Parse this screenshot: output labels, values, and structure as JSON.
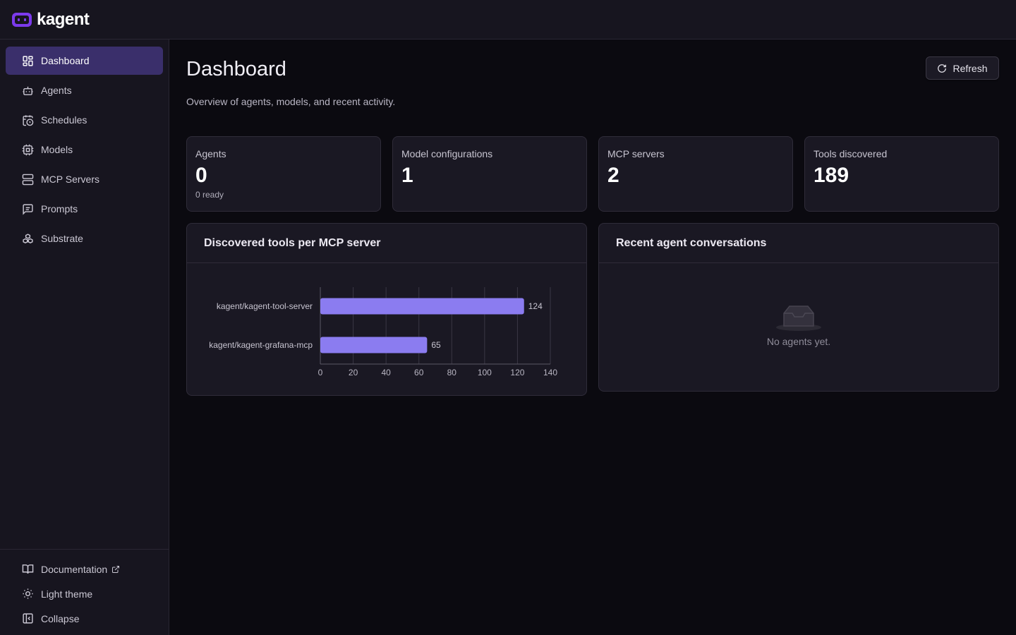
{
  "app": {
    "logo_text": "kagent",
    "brand_color": "#7c3aed"
  },
  "sidebar": {
    "items": [
      {
        "label": "Dashboard",
        "icon": "dashboard-icon",
        "active": true
      },
      {
        "label": "Agents",
        "icon": "bot-icon"
      },
      {
        "label": "Schedules",
        "icon": "calendar-clock-icon"
      },
      {
        "label": "Models",
        "icon": "cpu-icon"
      },
      {
        "label": "MCP Servers",
        "icon": "server-icon"
      },
      {
        "label": "Prompts",
        "icon": "message-square-icon"
      },
      {
        "label": "Substrate",
        "icon": "boxes-icon"
      }
    ],
    "footer": {
      "documentation": "Documentation",
      "theme": "Light theme",
      "collapse": "Collapse"
    }
  },
  "main": {
    "title": "Dashboard",
    "subtitle": "Overview of agents, models, and recent activity.",
    "refresh_label": "Refresh",
    "stats": [
      {
        "label": "Agents",
        "value": "0",
        "sub": "0 ready"
      },
      {
        "label": "Model configurations",
        "value": "1",
        "sub": ""
      },
      {
        "label": "MCP servers",
        "value": "2",
        "sub": ""
      },
      {
        "label": "Tools discovered",
        "value": "189",
        "sub": ""
      }
    ],
    "tools_panel_title": "Discovered tools per MCP server",
    "conversations_panel_title": "Recent agent conversations",
    "empty_text": "No agents yet."
  },
  "chart_data": {
    "type": "bar",
    "orientation": "horizontal",
    "categories": [
      "kagent/kagent-tool-server",
      "kagent/kagent-grafana-mcp"
    ],
    "values": [
      124,
      65
    ],
    "xlim": [
      0,
      140
    ],
    "xticks": [
      0,
      20,
      40,
      60,
      80,
      100,
      120,
      140
    ],
    "grid": true,
    "bar_color": "#8b7cf0",
    "data_labels": true
  }
}
